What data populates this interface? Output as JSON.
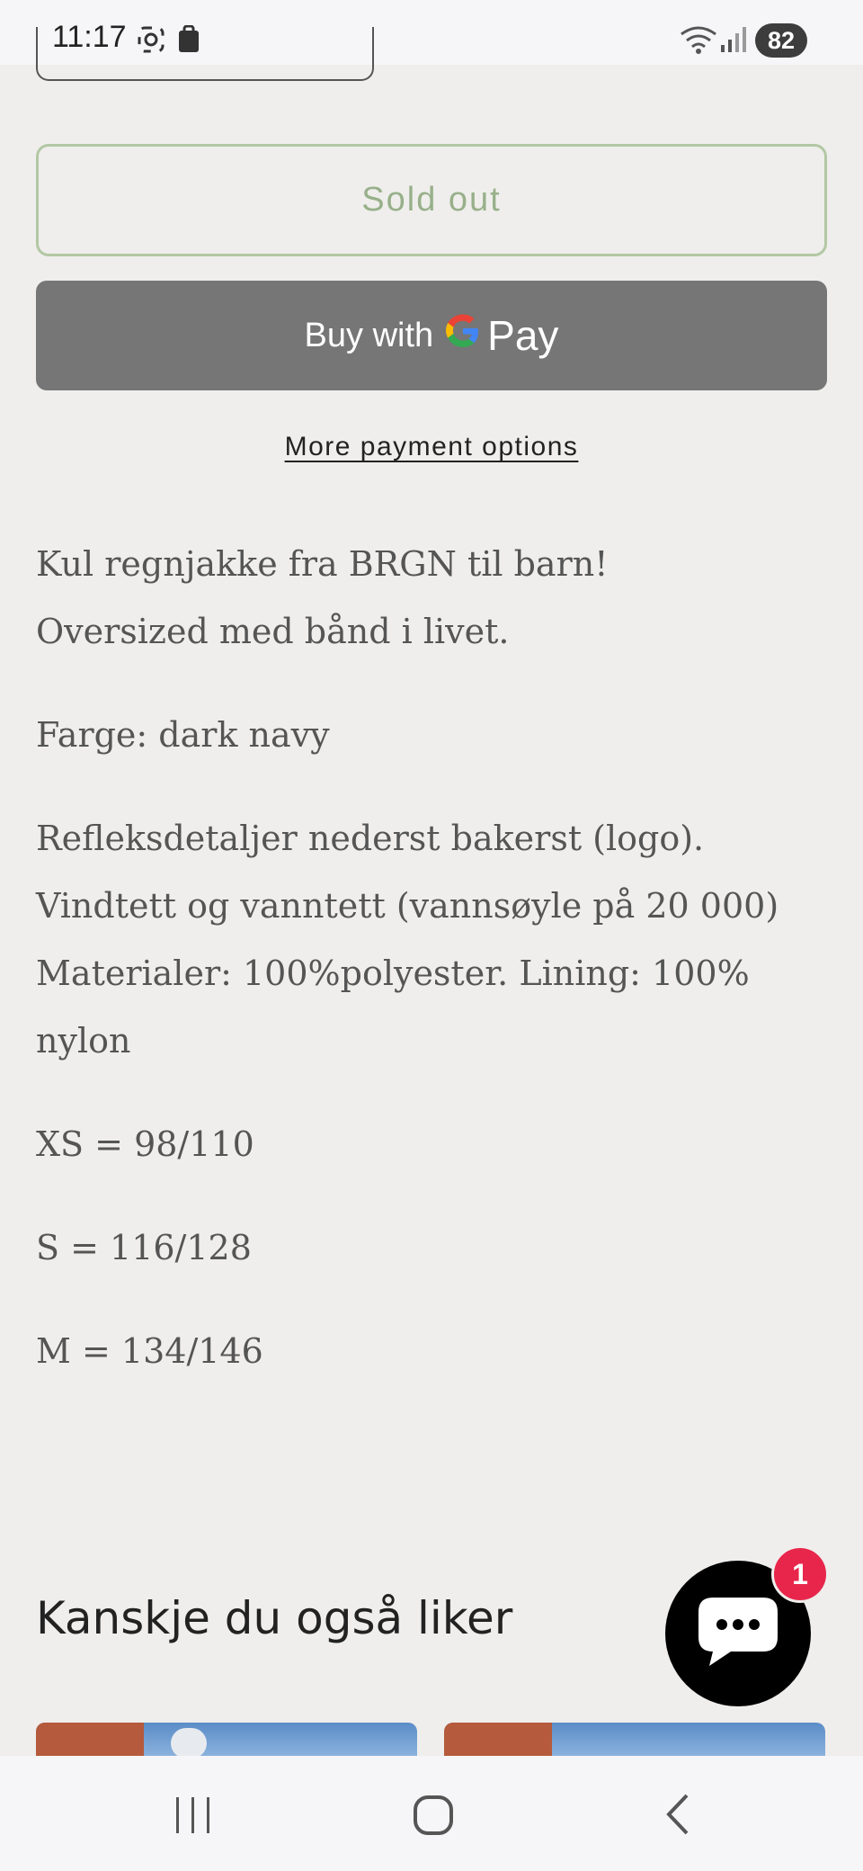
{
  "status_bar": {
    "time": "11:17",
    "battery": "82",
    "icons": [
      "screenshot-icon",
      "bag-icon",
      "wifi-icon",
      "signal-icon"
    ]
  },
  "buttons": {
    "sold_out": "Sold out",
    "buy_with": "Buy with",
    "pay": "Pay",
    "more_payment_options": "More payment options"
  },
  "description": {
    "lines1": [
      "Kul regnjakke fra BRGN til barn!",
      "Oversized med bånd i livet."
    ],
    "color": "Farge: dark navy",
    "details": [
      "Refleksdetaljer nederst bakerst (logo).",
      "Vindtett og vanntett (vannsøyle på 20 000)",
      "Materialer: 100%polyester. Lining: 100%",
      "nylon"
    ],
    "sizes": [
      "XS = 98/110",
      "S = 116/128",
      "M = 134/146"
    ]
  },
  "related": {
    "title": "Kanskje du også liker"
  },
  "chat": {
    "badge_count": "1"
  },
  "colors": {
    "background": "#efeeec",
    "sold_out_border": "#b2c8a4",
    "gpay_button": "#767676",
    "chat_badge": "#e8264b"
  }
}
